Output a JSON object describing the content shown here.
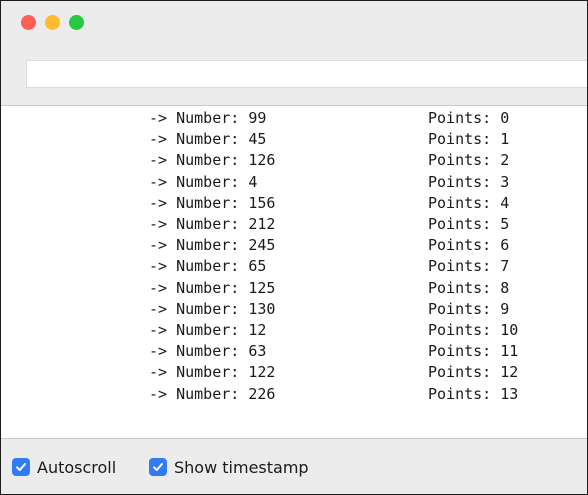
{
  "window": {
    "traffic_lights": {
      "close_color": "#fe5f57",
      "minimize_color": "#febc2e",
      "maximize_color": "#28c840"
    }
  },
  "send_input": {
    "value": "",
    "placeholder": ""
  },
  "output": {
    "lines": [
      {
        "number": "-> Number: 99",
        "points": "Points: 0"
      },
      {
        "number": "-> Number: 45",
        "points": "Points: 1"
      },
      {
        "number": "-> Number: 126",
        "points": "Points: 2"
      },
      {
        "number": "-> Number: 4",
        "points": "Points: 3"
      },
      {
        "number": "-> Number: 156",
        "points": "Points: 4"
      },
      {
        "number": "-> Number: 212",
        "points": "Points: 5"
      },
      {
        "number": "-> Number: 245",
        "points": "Points: 6"
      },
      {
        "number": "-> Number: 65",
        "points": "Points: 7"
      },
      {
        "number": "-> Number: 125",
        "points": "Points: 8"
      },
      {
        "number": "-> Number: 130",
        "points": "Points: 9"
      },
      {
        "number": "-> Number: 12",
        "points": "Points: 10"
      },
      {
        "number": "-> Number: 63",
        "points": "Points: 11"
      },
      {
        "number": "-> Number: 122",
        "points": "Points: 12"
      },
      {
        "number": "-> Number: 226",
        "points": "Points: 13"
      }
    ]
  },
  "statusbar": {
    "autoscroll_label": "Autoscroll",
    "autoscroll_checked": true,
    "timestamp_label": "Show timestamp",
    "timestamp_checked": true,
    "checkbox_color": "#2f7cf6"
  }
}
